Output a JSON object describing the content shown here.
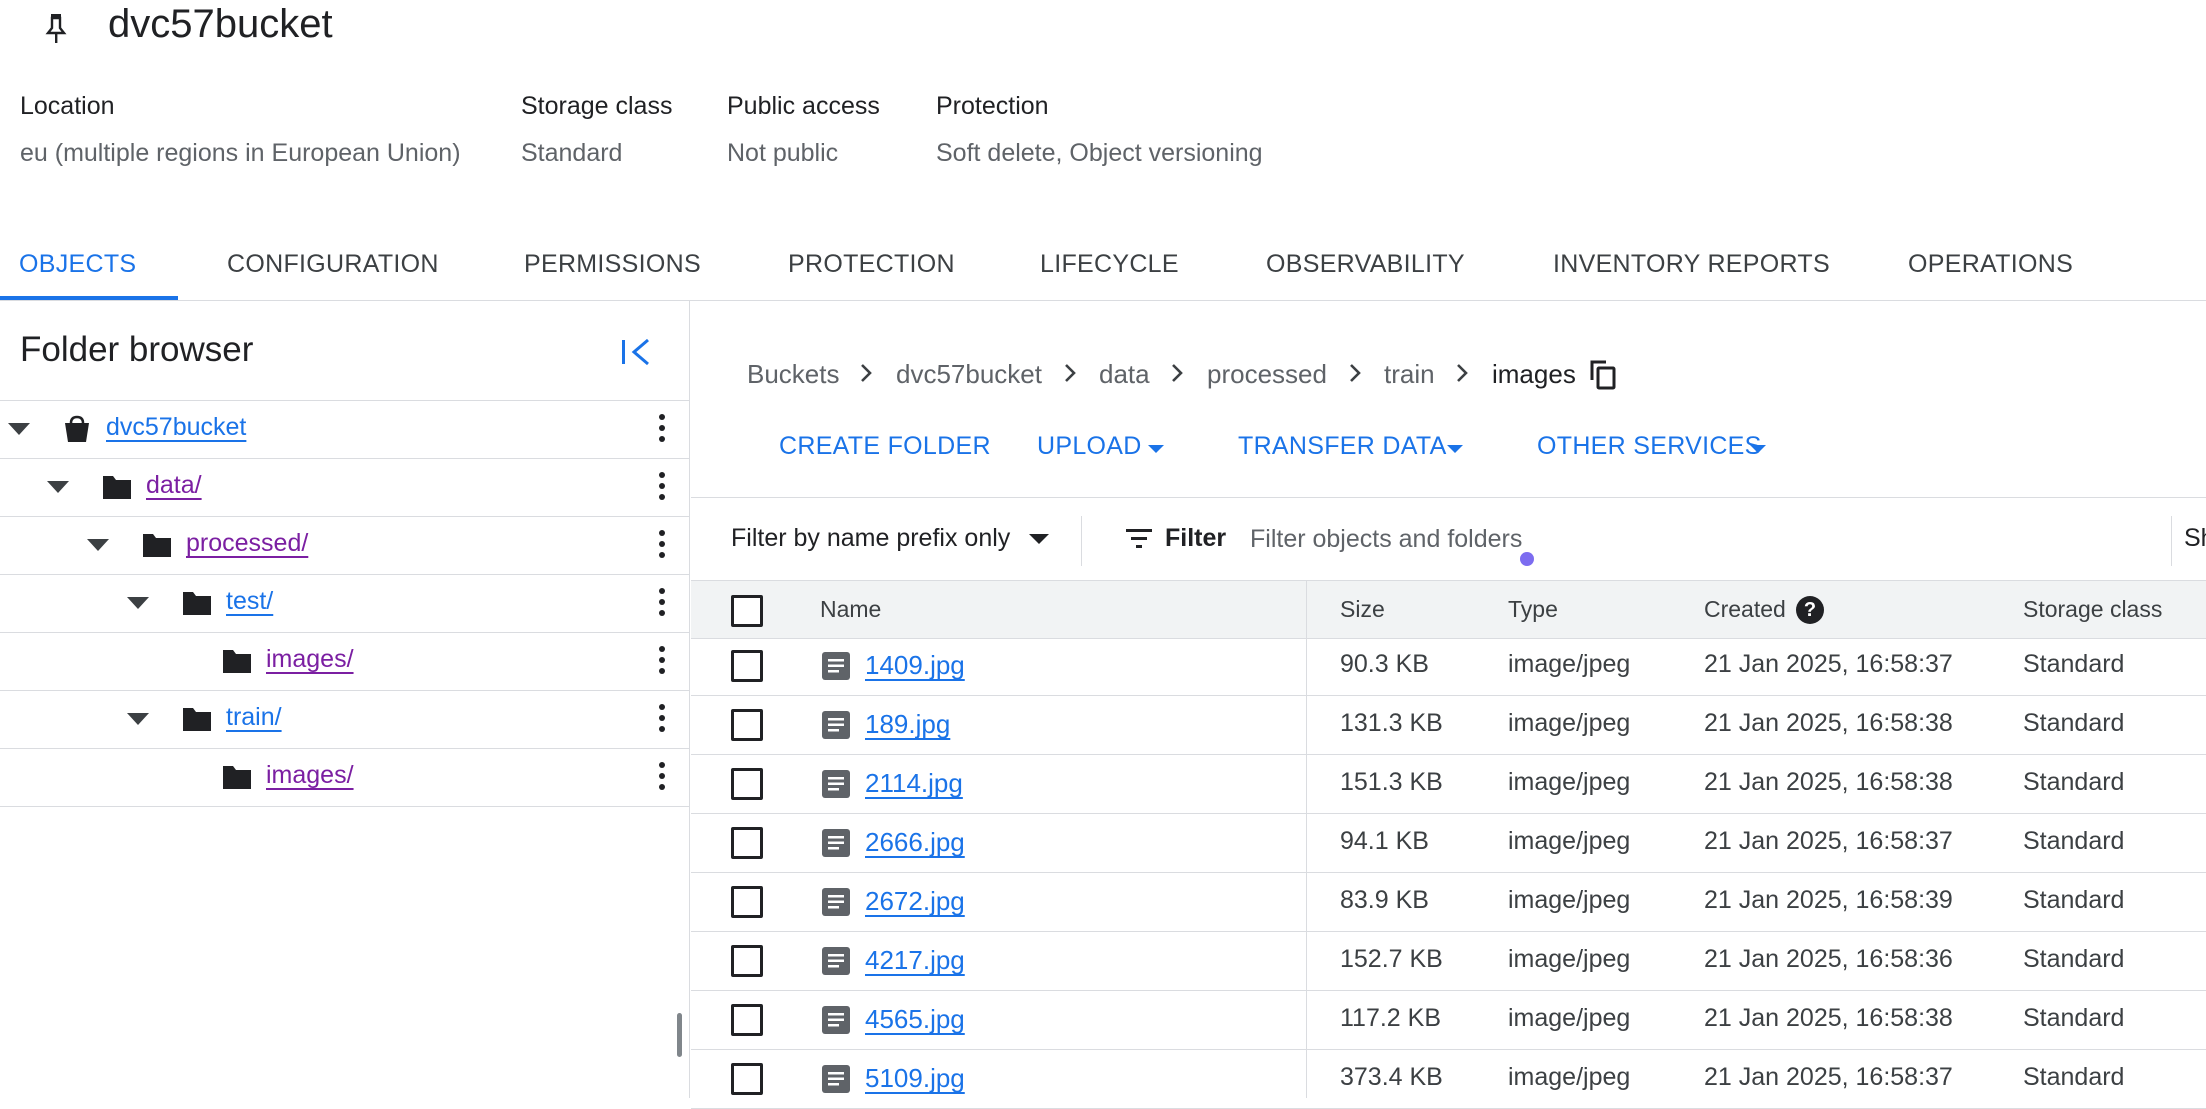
{
  "bucket": {
    "name": "dvc57bucket",
    "pin_icon": "pin-icon"
  },
  "meta": [
    {
      "label": "Location",
      "value": "eu (multiple regions in European Union)"
    },
    {
      "label": "Storage class",
      "value": "Standard"
    },
    {
      "label": "Public access",
      "value": "Not public"
    },
    {
      "label": "Protection",
      "value": "Soft delete, Object versioning"
    }
  ],
  "tabs": [
    {
      "label": "OBJECTS",
      "active": true
    },
    {
      "label": "CONFIGURATION"
    },
    {
      "label": "PERMISSIONS"
    },
    {
      "label": "PROTECTION"
    },
    {
      "label": "LIFECYCLE"
    },
    {
      "label": "OBSERVABILITY"
    },
    {
      "label": "INVENTORY REPORTS"
    },
    {
      "label": "OPERATIONS"
    }
  ],
  "folder_browser": {
    "title": "Folder browser",
    "collapse_icon": "collapse-panel-icon",
    "tree": [
      {
        "label": "dvc57bucket",
        "icon": "bucket-icon",
        "visited": false
      },
      {
        "label": "data/",
        "icon": "folder-icon",
        "visited": true
      },
      {
        "label": "processed/",
        "icon": "folder-icon",
        "visited": true
      },
      {
        "label": "test/",
        "icon": "folder-icon",
        "visited": false
      },
      {
        "label": "images/",
        "icon": "folder-icon",
        "visited": true
      },
      {
        "label": "train/",
        "icon": "folder-icon",
        "visited": false
      },
      {
        "label": "images/",
        "icon": "folder-icon",
        "visited": true
      }
    ]
  },
  "breadcrumbs": [
    "Buckets",
    "dvc57bucket",
    "data",
    "processed",
    "train",
    "images"
  ],
  "actions": {
    "create_folder": "CREATE FOLDER",
    "upload": "UPLOAD",
    "transfer_data": "TRANSFER DATA",
    "other_services": "OTHER SERVICES"
  },
  "filter": {
    "mode": "Filter by name prefix only",
    "label": "Filter",
    "placeholder": "Filter objects and folders",
    "show_truncated": "Sh"
  },
  "table": {
    "columns": [
      "Name",
      "Size",
      "Type",
      "Created",
      "Storage class"
    ],
    "rows": [
      {
        "name": "1409.jpg",
        "size": "90.3 KB",
        "type": "image/jpeg",
        "created": "21 Jan 2025, 16:58:37",
        "storage_class": "Standard"
      },
      {
        "name": "189.jpg",
        "size": "131.3 KB",
        "type": "image/jpeg",
        "created": "21 Jan 2025, 16:58:38",
        "storage_class": "Standard"
      },
      {
        "name": "2114.jpg",
        "size": "151.3 KB",
        "type": "image/jpeg",
        "created": "21 Jan 2025, 16:58:38",
        "storage_class": "Standard"
      },
      {
        "name": "2666.jpg",
        "size": "94.1 KB",
        "type": "image/jpeg",
        "created": "21 Jan 2025, 16:58:37",
        "storage_class": "Standard"
      },
      {
        "name": "2672.jpg",
        "size": "83.9 KB",
        "type": "image/jpeg",
        "created": "21 Jan 2025, 16:58:39",
        "storage_class": "Standard"
      },
      {
        "name": "4217.jpg",
        "size": "152.7 KB",
        "type": "image/jpeg",
        "created": "21 Jan 2025, 16:58:36",
        "storage_class": "Standard"
      },
      {
        "name": "4565.jpg",
        "size": "117.2 KB",
        "type": "image/jpeg",
        "created": "21 Jan 2025, 16:58:38",
        "storage_class": "Standard"
      },
      {
        "name": "5109.jpg",
        "size": "373.4 KB",
        "type": "image/jpeg",
        "created": "21 Jan 2025, 16:58:37",
        "storage_class": "Standard"
      }
    ]
  },
  "colors": {
    "accent": "#1a73e8",
    "visited_link": "#7b1fa2",
    "divider": "#dadce0"
  }
}
